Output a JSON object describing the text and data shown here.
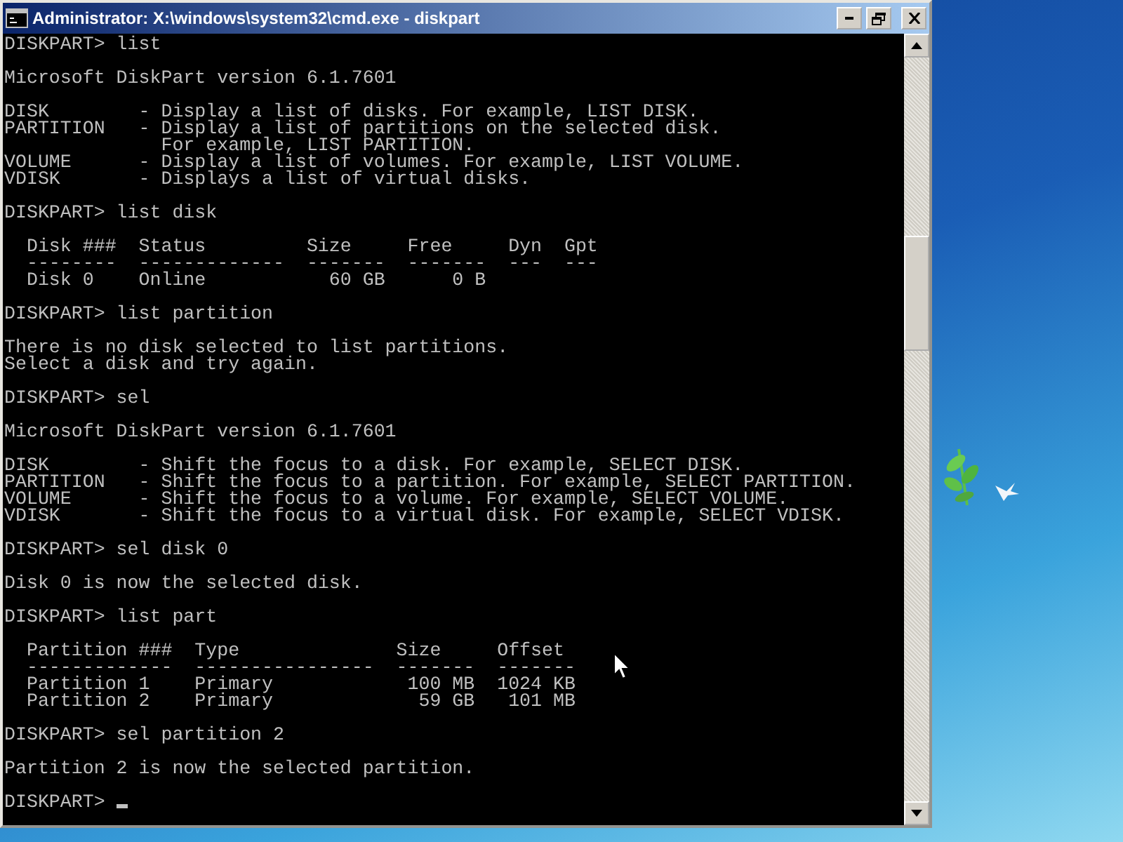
{
  "window": {
    "title": "Administrator: X:\\windows\\system32\\cmd.exe - diskpart"
  },
  "console": {
    "blocks": [
      [
        "DISKPART> list"
      ],
      [
        "Microsoft DiskPart version 6.1.7601"
      ],
      [
        "DISK        - Display a list of disks. For example, LIST DISK.",
        "PARTITION   - Display a list of partitions on the selected disk.",
        "              For example, LIST PARTITION.",
        "VOLUME      - Display a list of volumes. For example, LIST VOLUME.",
        "VDISK       - Displays a list of virtual disks."
      ],
      [
        "DISKPART> list disk"
      ],
      [
        "  Disk ###  Status         Size     Free     Dyn  Gpt",
        "  --------  -------------  -------  -------  ---  ---",
        "  Disk 0    Online           60 GB      0 B"
      ],
      [
        "DISKPART> list partition"
      ],
      [
        "There is no disk selected to list partitions.",
        "Select a disk and try again."
      ],
      [
        "DISKPART> sel"
      ],
      [
        "Microsoft DiskPart version 6.1.7601"
      ],
      [
        "DISK        - Shift the focus to a disk. For example, SELECT DISK.",
        "PARTITION   - Shift the focus to a partition. For example, SELECT PARTITION.",
        "VOLUME      - Shift the focus to a volume. For example, SELECT VOLUME.",
        "VDISK       - Shift the focus to a virtual disk. For example, SELECT VDISK."
      ],
      [
        "DISKPART> sel disk 0"
      ],
      [
        "Disk 0 is now the selected disk."
      ],
      [
        "DISKPART> list part"
      ],
      [
        "  Partition ###  Type              Size     Offset",
        "  -------------  ----------------  -------  -------",
        "  Partition 1    Primary            100 MB  1024 KB",
        "  Partition 2    Primary             59 GB   101 MB"
      ],
      [
        "DISKPART> sel partition 2"
      ],
      [
        "Partition 2 is now the selected partition."
      ]
    ],
    "prompt": "DISKPART>"
  }
}
